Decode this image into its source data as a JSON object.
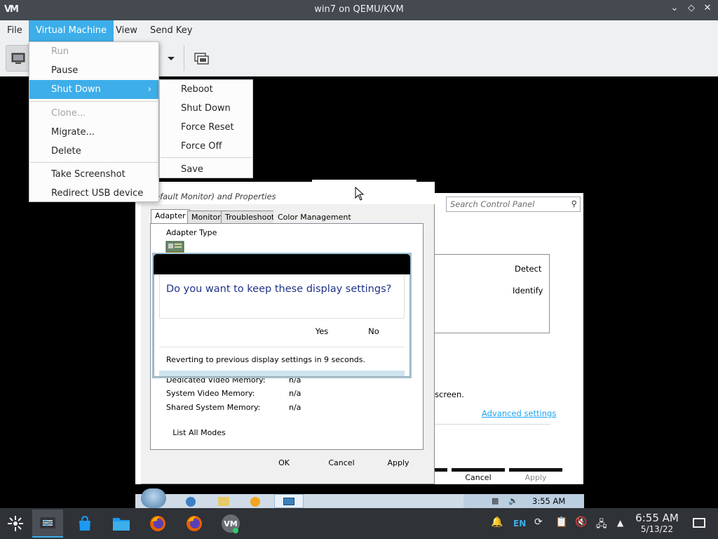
{
  "window": {
    "title": "win7 on QEMU/KVM",
    "logo": "VM",
    "controls": [
      "chevron-down-icon",
      "diamond-icon",
      "close-icon"
    ]
  },
  "menubar": {
    "file": "File",
    "virtual_machine": "Virtual Machine",
    "view": "View",
    "send_key": "Send Key"
  },
  "vm_menu": {
    "run": "Run",
    "pause": "Pause",
    "shut_down": "Shut Down",
    "clone": "Clone...",
    "migrate": "Migrate...",
    "delete": "Delete",
    "take_screenshot": "Take Screenshot",
    "redirect_usb": "Redirect USB device"
  },
  "shutdown_submenu": {
    "reboot": "Reboot",
    "shut_down": "Shut Down",
    "force_reset": "Force Reset",
    "force_off": "Force Off",
    "save": "Save"
  },
  "guest": {
    "control_panel": {
      "search_placeholder": "Search Control Panel",
      "detect": "Detect",
      "identify": "Identify",
      "screen_fragment": "screen.",
      "advanced_settings": "Advanced settings",
      "cancel": "Cancel",
      "apply": "Apply"
    },
    "properties": {
      "title": "efault Monitor) and  Properties",
      "tabs": [
        "Adapter",
        "Monitor",
        "Troubleshoot",
        "Color Management"
      ],
      "adapter_type_label": "Adapter Type",
      "memory_rows": [
        {
          "label": "Dedicated Video Memory:",
          "value": "n/a"
        },
        {
          "label": "System Video Memory:",
          "value": "n/a"
        },
        {
          "label": "Shared System Memory:",
          "value": "n/a"
        }
      ],
      "list_all_modes": "List All Modes",
      "ok": "OK",
      "cancel": "Cancel",
      "apply": "Apply"
    },
    "dialog": {
      "question": "Do you want to keep these display settings?",
      "yes": "Yes",
      "no": "No",
      "revert_text": "Reverting to previous display settings in 9 seconds."
    },
    "taskbar": {
      "clock": "3:55 AM"
    }
  },
  "host_taskbar": {
    "language": "EN",
    "time": "6:55 AM",
    "date": "5/13/22"
  },
  "colors": {
    "accent": "#3daee9",
    "link": "#1ea3f0",
    "dialog_text": "#1e3287"
  }
}
